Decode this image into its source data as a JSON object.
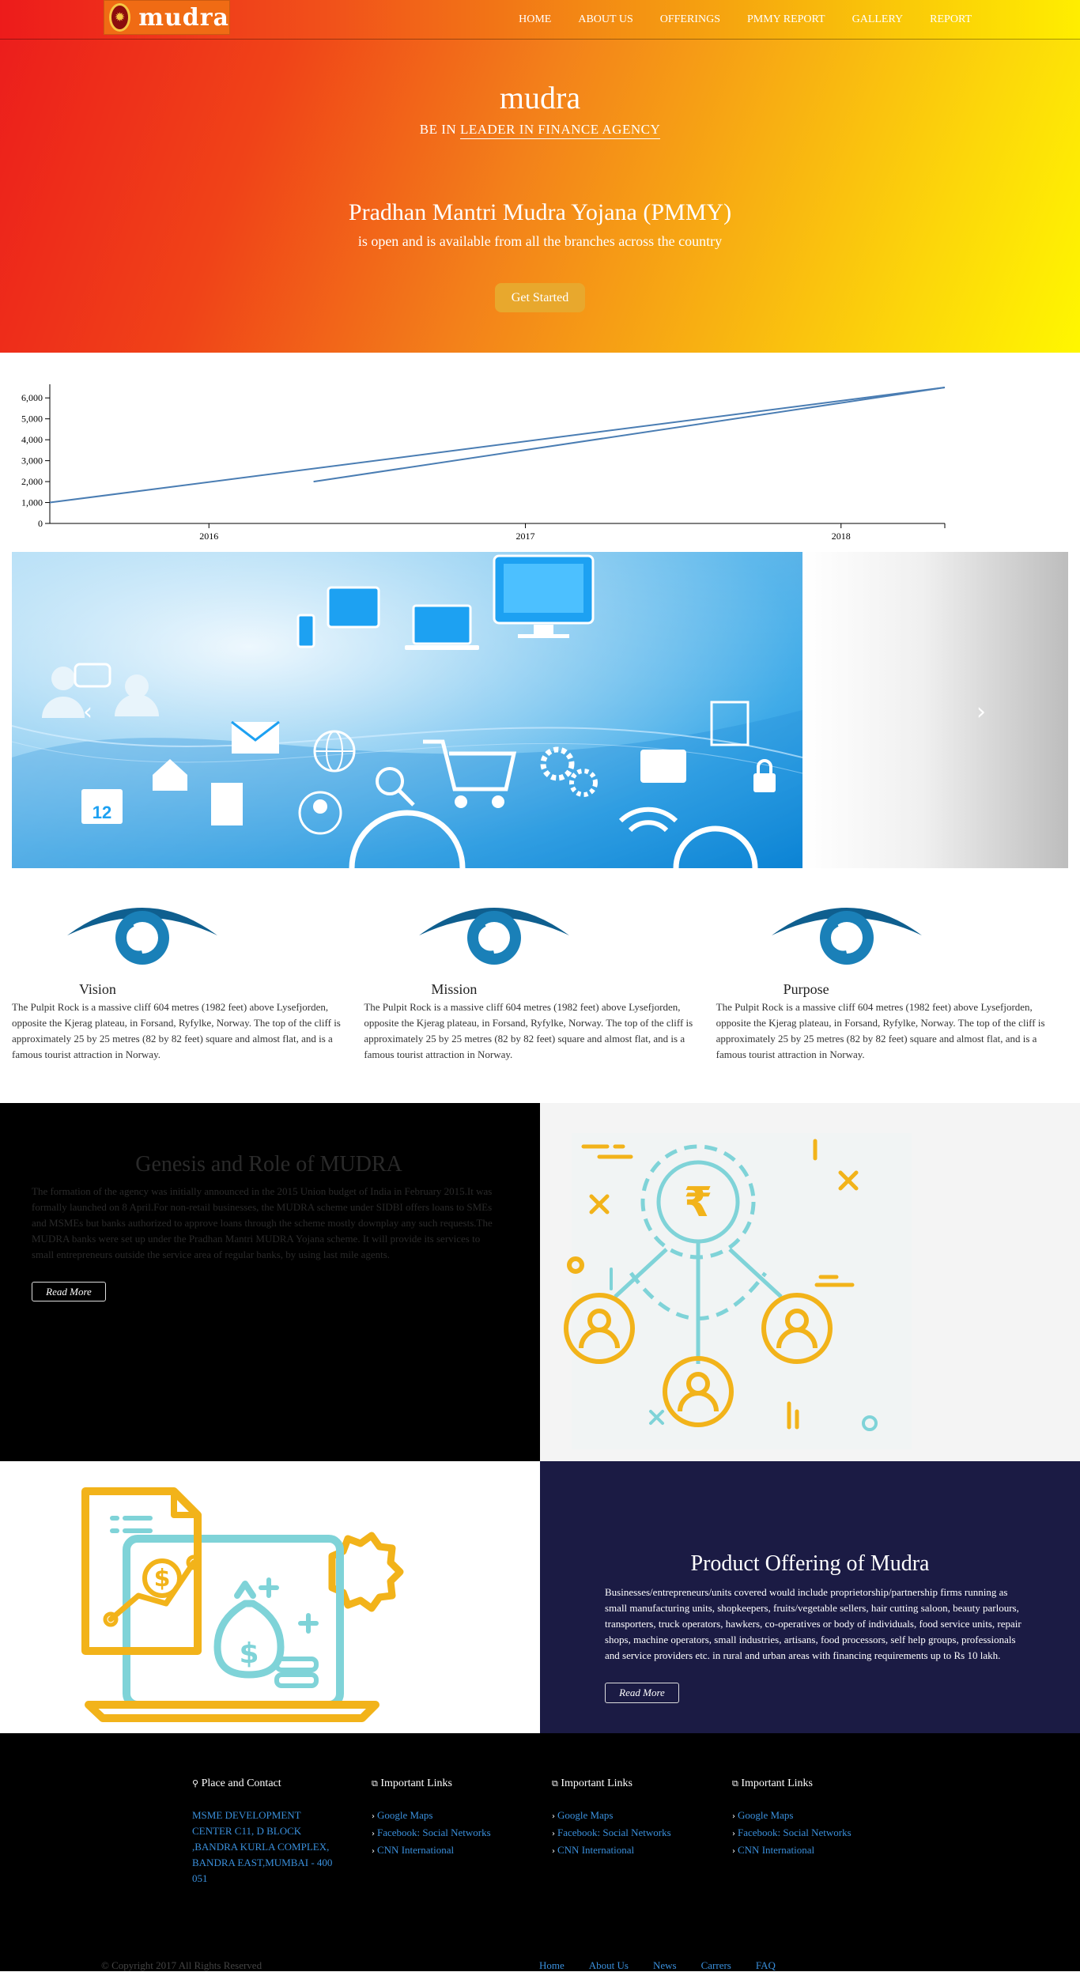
{
  "nav": {
    "logo_text": "mudra",
    "items": [
      "HOME",
      "ABOUT US",
      "OFFERINGS",
      "PMMY REPORT",
      "GALLERY",
      "REPORT"
    ]
  },
  "hero": {
    "brand": "mudra",
    "tagline_prefix": "BE IN ",
    "tagline_underlined": "LEADER IN FINANCE AGENCY",
    "heading": "Pradhan Mantri Mudra Yojana (PMMY)",
    "subheading": "is open and is available from all the branches across the country",
    "cta": "Get Started"
  },
  "chart_data": {
    "type": "line",
    "x_ticks": [
      "2016",
      "2017",
      "2018"
    ],
    "y_ticks": [
      "0",
      "1,000",
      "2,000",
      "3,000",
      "4,000",
      "5,000",
      "6,000"
    ],
    "ylim": [
      0,
      6500
    ],
    "series": [
      {
        "points": [
          [
            "2015-07-01",
            1000
          ],
          [
            "2018-05-01",
            6500
          ]
        ]
      },
      {
        "points": [
          [
            "2016-05-01",
            2000
          ],
          [
            "2018-05-01",
            6500
          ]
        ]
      }
    ],
    "color": "#4a7db3"
  },
  "carousel": {
    "prev_icon": "chevron-left-icon",
    "next_icon": "chevron-right-icon"
  },
  "features": [
    {
      "title": "Vision",
      "text": "The Pulpit Rock is a massive cliff 604 metres (1982 feet) above Lysefjorden, opposite the Kjerag plateau, in Forsand, Ryfylke, Norway. The top of the cliff is approximately 25 by 25 metres (82 by 82 feet) square and almost flat, and is a famous tourist attraction in Norway."
    },
    {
      "title": "Mission",
      "text": "The Pulpit Rock is a massive cliff 604 metres (1982 feet) above Lysefjorden, opposite the Kjerag plateau, in Forsand, Ryfylke, Norway. The top of the cliff is approximately 25 by 25 metres (82 by 82 feet) square and almost flat, and is a famous tourist attraction in Norway."
    },
    {
      "title": "Purpose",
      "text": "The Pulpit Rock is a massive cliff 604 metres (1982 feet) above Lysefjorden, opposite the Kjerag plateau, in Forsand, Ryfylke, Norway. The top of the cliff is approximately 25 by 25 metres (82 by 82 feet) square and almost flat, and is a famous tourist attraction in Norway."
    }
  ],
  "genesis": {
    "title": "Genesis and Role of MUDRA",
    "text": "The formation of the agency was initially announced in the 2015 Union budget of India in February 2015.It was formally launched on 8 April.For non-retail businesses, the MUDRA scheme under SIDBI offers loans to SMEs and MSMEs but banks authorized to approve loans through the scheme mostly downplay any such requests.The MUDRA banks were set up under the Pradhan Mantri MUDRA Yojana scheme. It will provide its services to small entrepreneurs outside the service area of regular banks, by using last mile agents.",
    "button": "Read More",
    "rupee": "₹"
  },
  "product": {
    "title": "Product Offering of Mudra",
    "text": "Businesses/entrepreneurs/units covered would include proprietorship/partnership firms running as small manufacturing units, shopkeepers, fruits/vegetable sellers, hair cutting saloon, beauty parlours, transporters, truck operators, hawkers, co-operatives or body of individuals, food service units, repair shops, machine operators, small industries, artisans, food processors, self help groups, professionals and service providers etc. in rural and urban areas with financing requirements up to Rs 10 lakh.",
    "button": "Read More",
    "dollar": "$"
  },
  "footer": {
    "contact_title": "Place and Contact",
    "address": "MSME DEVELOPMENT CENTER C11, D BLOCK ,BANDRA KURLA COMPLEX, BANDRA EAST,MUMBAI - 400 051",
    "links_title": "Important Links",
    "links": [
      "Google Maps",
      "Facebook: Social Networks",
      "CNN International"
    ],
    "copyright": "© Copyright 2017 All Rights Reserved",
    "bottom_links": [
      "Home",
      "About Us",
      "News",
      "Carrers",
      "FAQ"
    ]
  }
}
